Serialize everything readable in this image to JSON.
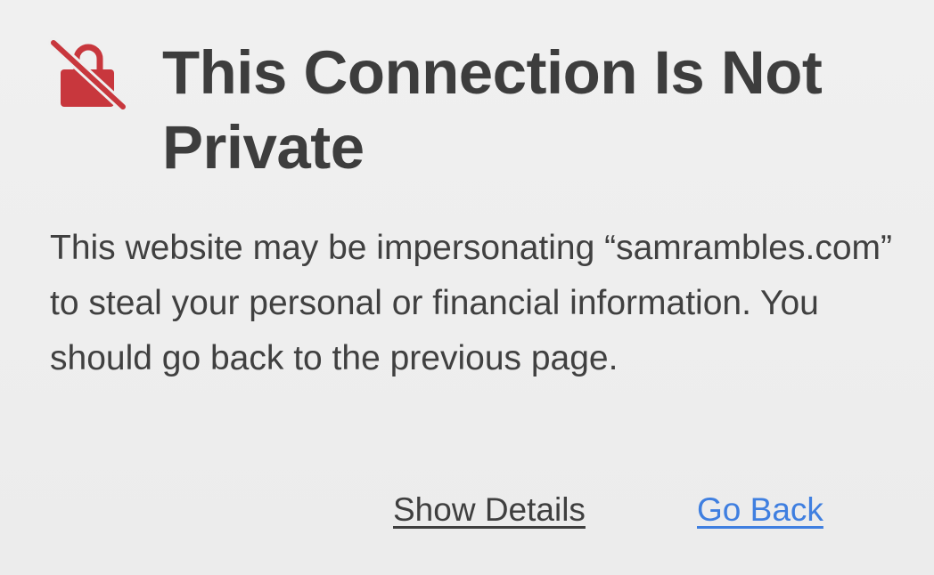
{
  "warning": {
    "icon": "lock-slash-icon",
    "title": "This Connection Is Not Private",
    "message": "This website may be impersonating “samrambles.com” to steal your personal or financial information. You should go back to the previous page.",
    "accent_color": "#c8373d"
  },
  "actions": {
    "show_details_label": "Show Details",
    "go_back_label": "Go Back",
    "link_color": "#3f7fe0"
  }
}
